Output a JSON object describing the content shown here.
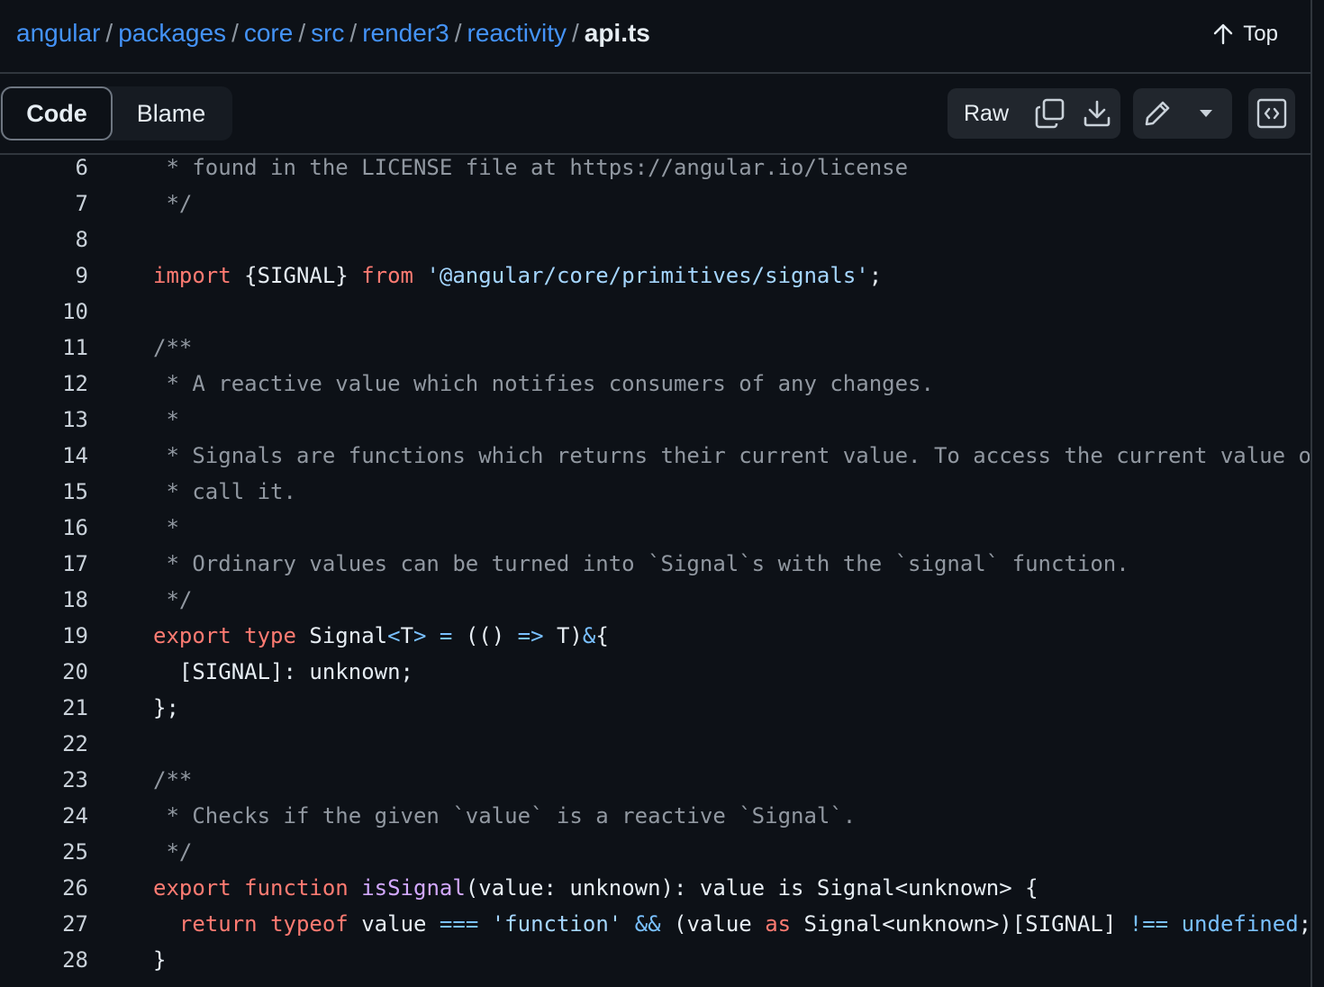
{
  "breadcrumb": {
    "segments": [
      "angular",
      "packages",
      "core",
      "src",
      "render3",
      "reactivity"
    ],
    "separator": "/",
    "current_file": "api.ts"
  },
  "top_link": {
    "label": "Top",
    "icon": "arrow-up-icon"
  },
  "view_tabs": [
    {
      "label": "Code",
      "active": true
    },
    {
      "label": "Blame",
      "active": false
    }
  ],
  "toolbar": {
    "raw_label": "Raw",
    "icons": [
      "copy-icon",
      "download-icon",
      "pencil-icon",
      "triangle-down-icon",
      "code-square-icon"
    ]
  },
  "colors": {
    "background": "#0d1117",
    "link": "#4493f8",
    "comment": "#9198a1",
    "keyword": "#ff7b72",
    "string": "#a5d6ff",
    "function": "#d2a8ff",
    "operator": "#79c0ff"
  },
  "code_lines": [
    {
      "n": "6",
      "tokens": [
        [
          " * found in the LICENSE file at https://angular.io/license",
          "c"
        ]
      ]
    },
    {
      "n": "7",
      "tokens": [
        [
          " */",
          "c"
        ]
      ]
    },
    {
      "n": "8",
      "tokens": []
    },
    {
      "n": "9",
      "tokens": [
        [
          "import",
          "k"
        ],
        [
          " {SIGNAL} ",
          ""
        ],
        [
          "from",
          "k"
        ],
        [
          " ",
          ""
        ],
        [
          "'@angular/core/primitives/signals'",
          "s"
        ],
        [
          ";",
          ""
        ]
      ]
    },
    {
      "n": "10",
      "tokens": []
    },
    {
      "n": "11",
      "tokens": [
        [
          "/**",
          "c"
        ]
      ]
    },
    {
      "n": "12",
      "tokens": [
        [
          " * A reactive value which notifies consumers of any changes.",
          "c"
        ]
      ]
    },
    {
      "n": "13",
      "tokens": [
        [
          " *",
          "c"
        ]
      ]
    },
    {
      "n": "14",
      "tokens": [
        [
          " * Signals are functions which returns their current value. To access the current value of a signal,",
          "c"
        ]
      ]
    },
    {
      "n": "15",
      "tokens": [
        [
          " * call it.",
          "c"
        ]
      ]
    },
    {
      "n": "16",
      "tokens": [
        [
          " *",
          "c"
        ]
      ]
    },
    {
      "n": "17",
      "tokens": [
        [
          " * Ordinary values can be turned into `Signal`s with the `signal` function.",
          "c"
        ]
      ]
    },
    {
      "n": "18",
      "tokens": [
        [
          " */",
          "c"
        ]
      ]
    },
    {
      "n": "19",
      "tokens": [
        [
          "export",
          "k"
        ],
        [
          " ",
          ""
        ],
        [
          "type",
          "k"
        ],
        [
          " Signal",
          ""
        ],
        [
          "<",
          "o"
        ],
        [
          "T",
          ""
        ],
        [
          ">",
          "o"
        ],
        [
          " ",
          ""
        ],
        [
          "=",
          "o"
        ],
        [
          " (() ",
          ""
        ],
        [
          "=>",
          "o"
        ],
        [
          " T)",
          ""
        ],
        [
          "&",
          "o"
        ],
        [
          "{",
          ""
        ]
      ]
    },
    {
      "n": "20",
      "tokens": [
        [
          "  [SIGNAL]: unknown;",
          ""
        ]
      ]
    },
    {
      "n": "21",
      "tokens": [
        [
          "};",
          ""
        ]
      ]
    },
    {
      "n": "22",
      "tokens": []
    },
    {
      "n": "23",
      "tokens": [
        [
          "/**",
          "c"
        ]
      ]
    },
    {
      "n": "24",
      "tokens": [
        [
          " * Checks if the given `value` is a reactive `Signal`.",
          "c"
        ]
      ]
    },
    {
      "n": "25",
      "tokens": [
        [
          " */",
          "c"
        ]
      ]
    },
    {
      "n": "26",
      "tokens": [
        [
          "export",
          "k"
        ],
        [
          " ",
          ""
        ],
        [
          "function",
          "k"
        ],
        [
          " ",
          ""
        ],
        [
          "isSignal",
          "f"
        ],
        [
          "(value: unknown): value is Signal<unknown> {",
          ""
        ]
      ]
    },
    {
      "n": "27",
      "tokens": [
        [
          "  ",
          ""
        ],
        [
          "return",
          "k"
        ],
        [
          " ",
          ""
        ],
        [
          "typeof",
          "k"
        ],
        [
          " value ",
          ""
        ],
        [
          "===",
          "o"
        ],
        [
          " ",
          ""
        ],
        [
          "'function'",
          "s"
        ],
        [
          " ",
          ""
        ],
        [
          "&&",
          "o"
        ],
        [
          " (value ",
          ""
        ],
        [
          "as",
          "k"
        ],
        [
          " Signal<unknown>)[SIGNAL] ",
          ""
        ],
        [
          "!==",
          "o"
        ],
        [
          " ",
          ""
        ],
        [
          "undefined",
          "o"
        ],
        [
          ";",
          ""
        ]
      ]
    },
    {
      "n": "28",
      "tokens": [
        [
          "}",
          ""
        ]
      ]
    }
  ]
}
